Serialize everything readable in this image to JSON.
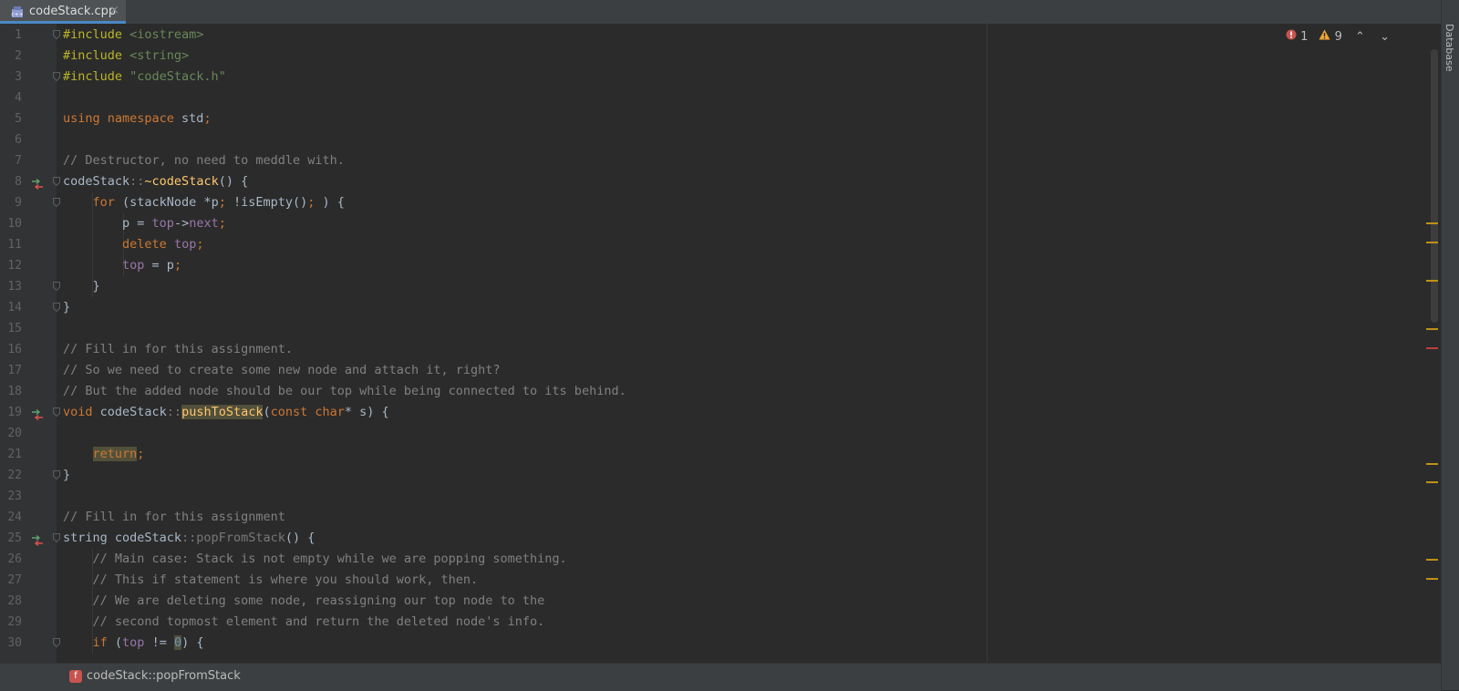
{
  "tab": {
    "filename": "codeStack.cpp",
    "close_glyph": "×",
    "icon": "cpp-file-icon"
  },
  "inspection": {
    "errors": "1",
    "warnings": "9",
    "up": "⌃",
    "down": "⌄"
  },
  "right_panel": {
    "label": "Database"
  },
  "breadcrumb": {
    "label": "codeStack::popFromStack",
    "icon_letter": "f"
  },
  "colors": {
    "keyword": "#cc7832",
    "preprocessor": "#bbb529",
    "string": "#6a8759",
    "comment": "#808080",
    "function": "#ffc66d",
    "field": "#9876aa",
    "plain": "#a9b7c6",
    "warning_marker": "#be9117",
    "error_marker": "#bc3f3c"
  },
  "lines": [
    {
      "num": "1",
      "tokens": [
        [
          "pp",
          "#include "
        ],
        [
          "str",
          "<iostream>"
        ]
      ]
    },
    {
      "num": "2",
      "tokens": [
        [
          "pp",
          "#include "
        ],
        [
          "str",
          "<string>"
        ]
      ]
    },
    {
      "num": "3",
      "tokens": [
        [
          "pp",
          "#include "
        ],
        [
          "str",
          "\"codeStack.h\""
        ]
      ]
    },
    {
      "num": "4",
      "tokens": []
    },
    {
      "num": "5",
      "tokens": [
        [
          "kw",
          "using namespace "
        ],
        [
          "plain",
          "std"
        ],
        [
          "kw",
          ";"
        ]
      ]
    },
    {
      "num": "6",
      "tokens": []
    },
    {
      "num": "7",
      "tokens": [
        [
          "com",
          "// Destructor, no need to meddle with."
        ]
      ]
    },
    {
      "num": "8",
      "tokens": [
        [
          "plain",
          "codeStack"
        ],
        [
          "dim",
          "::"
        ],
        [
          "fn",
          "~codeStack"
        ],
        [
          "plain",
          "() {"
        ]
      ]
    },
    {
      "num": "9",
      "tokens": [
        [
          "plain",
          "    "
        ],
        [
          "kw",
          "for "
        ],
        [
          "plain",
          "(stackNode *p"
        ],
        [
          "kw",
          "; "
        ],
        [
          "plain",
          "!isEmpty()"
        ],
        [
          "kw",
          "; "
        ],
        [
          "plain",
          ") {"
        ]
      ]
    },
    {
      "num": "10",
      "tokens": [
        [
          "plain",
          "        p = "
        ],
        [
          "fld",
          "top"
        ],
        [
          "plain",
          "->"
        ],
        [
          "fld",
          "next"
        ],
        [
          "kw",
          ";"
        ]
      ]
    },
    {
      "num": "11",
      "tokens": [
        [
          "plain",
          "        "
        ],
        [
          "kw",
          "delete "
        ],
        [
          "fld",
          "top"
        ],
        [
          "kw",
          ";"
        ]
      ]
    },
    {
      "num": "12",
      "tokens": [
        [
          "plain",
          "        "
        ],
        [
          "fld",
          "top"
        ],
        [
          "plain",
          " = p"
        ],
        [
          "kw",
          ";"
        ]
      ]
    },
    {
      "num": "13",
      "tokens": [
        [
          "plain",
          "    }"
        ]
      ]
    },
    {
      "num": "14",
      "tokens": [
        [
          "plain",
          "}"
        ]
      ]
    },
    {
      "num": "15",
      "tokens": []
    },
    {
      "num": "16",
      "tokens": [
        [
          "com",
          "// Fill in for this assignment."
        ]
      ]
    },
    {
      "num": "17",
      "tokens": [
        [
          "com",
          "// So we need to create some new node and attach it, right?"
        ]
      ]
    },
    {
      "num": "18",
      "tokens": [
        [
          "com",
          "// But the added node should be our top while being connected to its behind."
        ]
      ]
    },
    {
      "num": "19",
      "tokens": [
        [
          "kw",
          "void "
        ],
        [
          "plain",
          "codeStack"
        ],
        [
          "dim",
          "::"
        ],
        [
          "fnhl",
          "pushToStack"
        ],
        [
          "plain",
          "("
        ],
        [
          "kw",
          "const char"
        ],
        [
          "plain",
          "* s) {"
        ]
      ]
    },
    {
      "num": "20",
      "tokens": []
    },
    {
      "num": "21",
      "tokens": [
        [
          "plain",
          "    "
        ],
        [
          "kwhl",
          "return"
        ],
        [
          "kw",
          ";"
        ]
      ]
    },
    {
      "num": "22",
      "tokens": [
        [
          "plain",
          "}"
        ]
      ]
    },
    {
      "num": "23",
      "tokens": []
    },
    {
      "num": "24",
      "tokens": [
        [
          "com",
          "// Fill in for this assignment"
        ]
      ]
    },
    {
      "num": "25",
      "tokens": [
        [
          "plain",
          "string codeStack"
        ],
        [
          "dim",
          "::popFromStack"
        ],
        [
          "plain",
          "() {"
        ]
      ]
    },
    {
      "num": "26",
      "tokens": [
        [
          "plain",
          "    "
        ],
        [
          "com",
          "// Main case: Stack is not empty while we are popping something."
        ]
      ]
    },
    {
      "num": "27",
      "tokens": [
        [
          "plain",
          "    "
        ],
        [
          "com",
          "// This if statement is where you should work, then."
        ]
      ]
    },
    {
      "num": "28",
      "tokens": [
        [
          "plain",
          "    "
        ],
        [
          "com",
          "// We are deleting some node, reassigning our top node to the"
        ]
      ]
    },
    {
      "num": "29",
      "tokens": [
        [
          "plain",
          "    "
        ],
        [
          "com",
          "// second topmost element and return the deleted node's info."
        ]
      ]
    },
    {
      "num": "30",
      "tokens": [
        [
          "plain",
          "    "
        ],
        [
          "kw",
          "if "
        ],
        [
          "plain",
          "("
        ],
        [
          "fld",
          "top"
        ],
        [
          "plain",
          " != "
        ],
        [
          "numhl",
          "0"
        ],
        [
          "plain",
          ") {"
        ]
      ]
    }
  ],
  "fold_lines": [
    "1",
    "3",
    "8",
    "9",
    "13",
    "14",
    "19",
    "22",
    "25",
    "30"
  ],
  "impl_lines": [
    "8",
    "19",
    "25"
  ]
}
